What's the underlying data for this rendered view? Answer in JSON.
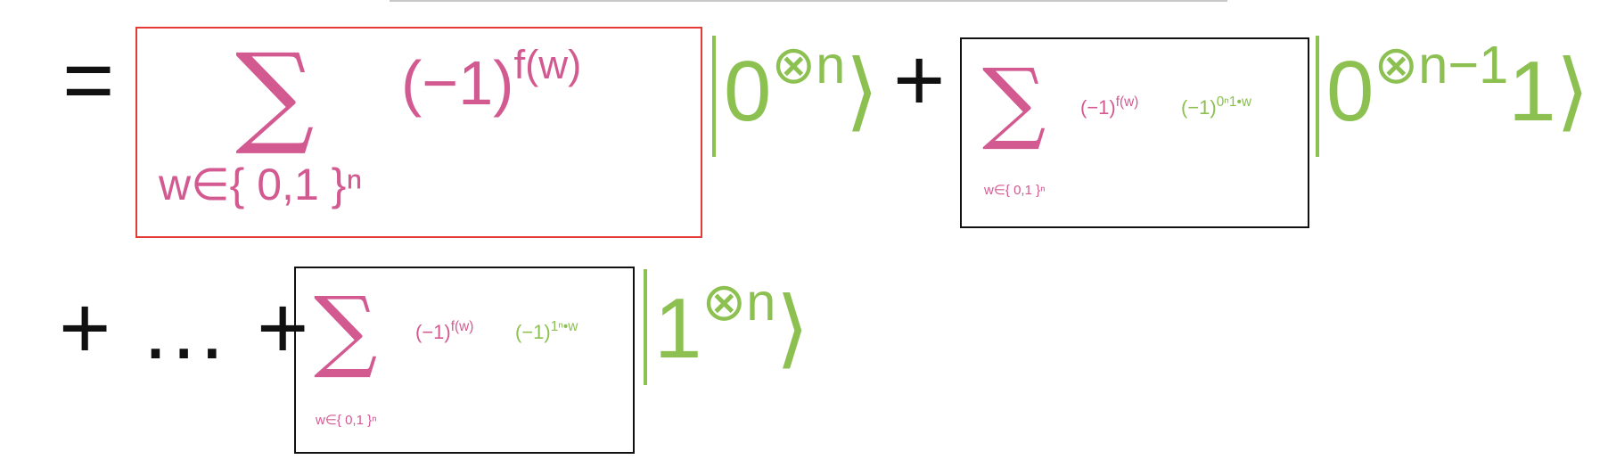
{
  "equation": {
    "line1": {
      "equals": "=",
      "box1": {
        "sigma": "∑",
        "subscript": "w∈{ 0,1 }ⁿ",
        "factor_base": "(−1)",
        "factor_exp": "f(w)"
      },
      "ket1": {
        "base": "0",
        "exp": "⊗n"
      },
      "plus": "+",
      "box2": {
        "sigma": "∑",
        "subscript": "w∈{ 0,1 }ⁿ",
        "factor1_base": "(−1)",
        "factor1_exp": "f(w)",
        "factor2_base": "(−1)",
        "factor2_exp": "0ⁿ1•w"
      },
      "ket2": {
        "base": "0",
        "exp": "⊗n−1",
        "tail": "1"
      }
    },
    "line2": {
      "lead": "+ … +",
      "box3": {
        "sigma": "∑",
        "subscript": "w∈{ 0,1 }ⁿ",
        "factor1_base": "(−1)",
        "factor1_exp": "f(w)",
        "factor2_base": "(−1)",
        "factor2_exp": "1ⁿ•w"
      },
      "ket3": {
        "base": "1",
        "exp": "⊗n"
      }
    }
  },
  "colors": {
    "sum_terms": "#d35a91",
    "kets": "#8cc152",
    "operators": "#111111",
    "highlight_box": "#e53935",
    "plain_box": "#111111"
  }
}
